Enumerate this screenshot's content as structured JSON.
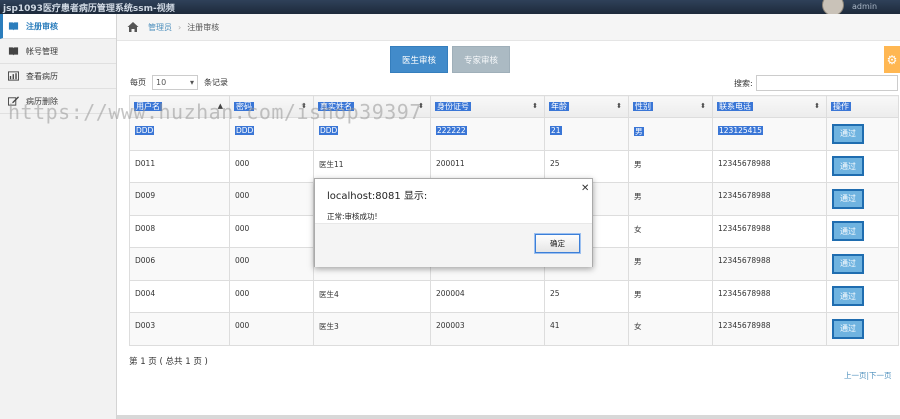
{
  "topbar": {
    "title": "jsp1093医疗患者病历管理系统ssm-视频",
    "user": "admin"
  },
  "sidebar": {
    "items": [
      {
        "label": "注册审核",
        "icon": "book-icon"
      },
      {
        "label": "帐号管理",
        "icon": "book-icon"
      },
      {
        "label": "查看病历",
        "icon": "bar-chart-icon"
      },
      {
        "label": "病历删除",
        "icon": "edit-icon"
      }
    ]
  },
  "breadcrumb": {
    "home": "管理员",
    "current": "注册审核"
  },
  "tabs": {
    "doctor": "医生审核",
    "expert": "专家审核"
  },
  "toolbar": {
    "perpage_prefix": "每页",
    "perpage_value": "10",
    "perpage_suffix": "条记录",
    "search_label": "搜索:"
  },
  "table": {
    "headers": [
      "用户名",
      "密码",
      "真实姓名",
      "身份证号",
      "年龄",
      "性别",
      "联系电话",
      "操作"
    ],
    "action_label": "通过",
    "rows": [
      [
        "DDD",
        "DDD",
        "DDD",
        "222222",
        "21",
        "男",
        "123125415"
      ],
      [
        "D011",
        "000",
        "医生11",
        "200011",
        "25",
        "男",
        "12345678988"
      ],
      [
        "D009",
        "000",
        "",
        "",
        "",
        "男",
        "12345678988"
      ],
      [
        "D008",
        "000",
        "",
        "",
        "",
        "女",
        "12345678988"
      ],
      [
        "D006",
        "000",
        "",
        "",
        "",
        "男",
        "12345678988"
      ],
      [
        "D004",
        "000",
        "医生4",
        "200004",
        "25",
        "男",
        "12345678988"
      ],
      [
        "D003",
        "000",
        "医生3",
        "200003",
        "41",
        "女",
        "12345678988"
      ]
    ]
  },
  "pagination": {
    "info": "第 1 页 ( 总共 1 页 )",
    "prev": "上一页",
    "next": "下一页"
  },
  "watermark": "https://www.huzhan.com/ishop39397",
  "dialog": {
    "title": "localhost:8081 显示:",
    "message": "正常:审核成功!",
    "ok": "确定"
  },
  "colors": {
    "primary": "#428bca",
    "sidebar_active": "#2b7dbc",
    "highlight": "#3a76d6",
    "pass_button": "#6fb3e0"
  }
}
